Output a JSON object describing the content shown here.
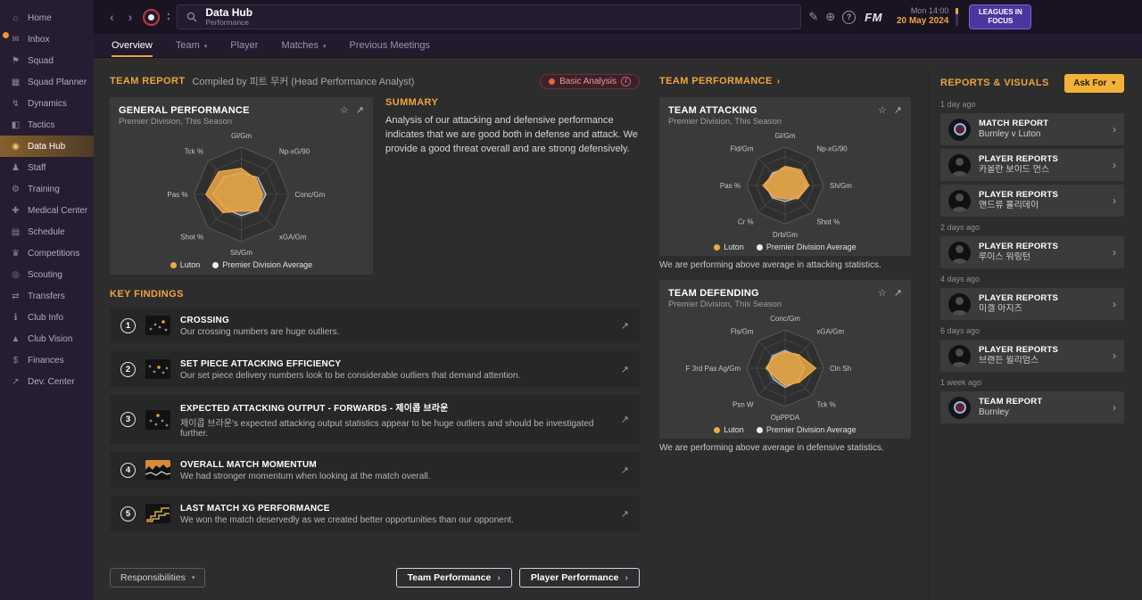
{
  "colors": {
    "accent": "#f0a43c",
    "luton_series": "#edaa43",
    "average_series": "#ececec",
    "badge_bg": "#3f2028",
    "askfor_bg": "#f2b237",
    "leagues_bg": "#4a36a0"
  },
  "icons": {
    "caret_down": "▾",
    "caret_up": "▴",
    "chev_left": "‹",
    "chev_right": "›",
    "star": "☆",
    "expand": "↗",
    "pencil": "✎",
    "globe": "⊕",
    "help": "?",
    "info": "i",
    "fm": "FM"
  },
  "sidebar": {
    "items": [
      {
        "name": "home",
        "label": "Home",
        "glyph": "⌂"
      },
      {
        "name": "inbox",
        "label": "Inbox",
        "glyph": "✉"
      },
      {
        "name": "squad",
        "label": "Squad",
        "glyph": "⚑"
      },
      {
        "name": "squad-planner",
        "label": "Squad Planner",
        "glyph": "▦"
      },
      {
        "name": "dynamics",
        "label": "Dynamics",
        "glyph": "↯"
      },
      {
        "name": "tactics",
        "label": "Tactics",
        "glyph": "◧"
      },
      {
        "name": "data-hub",
        "label": "Data Hub",
        "glyph": "◉"
      },
      {
        "name": "staff",
        "label": "Staff",
        "glyph": "♟"
      },
      {
        "name": "training",
        "label": "Training",
        "glyph": "⚙"
      },
      {
        "name": "medical-center",
        "label": "Medical Center",
        "glyph": "✚"
      },
      {
        "name": "schedule",
        "label": "Schedule",
        "glyph": "▤"
      },
      {
        "name": "competitions",
        "label": "Competitions",
        "glyph": "♛"
      },
      {
        "name": "scouting",
        "label": "Scouting",
        "glyph": "◎"
      },
      {
        "name": "transfers",
        "label": "Transfers",
        "glyph": "⇄"
      },
      {
        "name": "club-info",
        "label": "Club Info",
        "glyph": "ℹ"
      },
      {
        "name": "club-vision",
        "label": "Club Vision",
        "glyph": "▲"
      },
      {
        "name": "finances",
        "label": "Finances",
        "glyph": "$"
      },
      {
        "name": "dev-center",
        "label": "Dev. Center",
        "glyph": "↗"
      }
    ]
  },
  "topbar": {
    "title": "Data Hub",
    "subtitle": "Performance",
    "time": "Mon 14:00",
    "date": "20 May 2024",
    "leagues_button": "LEAGUES IN FOCUS"
  },
  "tabs": [
    {
      "label": "Overview"
    },
    {
      "label": "Team"
    },
    {
      "label": "Player"
    },
    {
      "label": "Matches"
    },
    {
      "label": "Previous Meetings"
    }
  ],
  "team_report": {
    "label": "TEAM REPORT",
    "compiled": "Compiled by 피트 무커 (Head Performance Analyst)",
    "badge": "Basic Analysis"
  },
  "general_performance": {
    "title": "GENERAL PERFORMANCE",
    "subtitle": "Premier Division, This Season"
  },
  "summary": {
    "label": "SUMMARY",
    "text": "Analysis of our attacking and defensive performance indicates that we are good both in defense and attack. We provide a good threat overall and are strong defensively."
  },
  "key_findings": {
    "label": "KEY FINDINGS",
    "items": [
      {
        "num": "1",
        "title": "CROSSING",
        "desc": "Our crossing numbers are huge outliers."
      },
      {
        "num": "2",
        "title": "SET PIECE ATTACKING EFFICIENCY",
        "desc": "Our set piece delivery numbers look to be considerable outliers that demand attention."
      },
      {
        "num": "3",
        "title": "EXPECTED ATTACKING OUTPUT - FORWARDS - 제이콥 브라운",
        "desc": "제이콥 브라운's expected attacking output statistics appear to be huge outliers and should be investigated further."
      },
      {
        "num": "4",
        "title": "OVERALL MATCH MOMENTUM",
        "desc": "We had stronger momentum when looking at the match overall."
      },
      {
        "num": "5",
        "title": "LAST MATCH XG PERFORMANCE",
        "desc": "We won the match deservedly as we created better opportunities than our opponent."
      }
    ]
  },
  "footer": {
    "responsibilities": "Responsibilities",
    "team_performance": "Team Performance",
    "player_performance": "Player Performance"
  },
  "team_performance_col": {
    "label": "TEAM PERFORMANCE",
    "attacking": {
      "title": "TEAM ATTACKING",
      "subtitle": "Premier Division, This Season",
      "note": "We are performing above average in attacking statistics."
    },
    "defending": {
      "title": "TEAM DEFENDING",
      "subtitle": "Premier Division, This Season",
      "note": "We are performing above average in defensive statistics."
    }
  },
  "reports": {
    "label": "REPORTS & VISUALS",
    "ask_for": "Ask For",
    "rows": [
      {
        "kind": "time",
        "text": "1 day ago"
      },
      {
        "kind": "match",
        "type": "MATCH REPORT",
        "subject": "Burnley v Luton"
      },
      {
        "kind": "player",
        "type": "PLAYER REPORTS",
        "subject": "카올란 보이드 먼스"
      },
      {
        "kind": "player",
        "type": "PLAYER REPORTS",
        "subject": "앤드류 홀리데이"
      },
      {
        "kind": "time",
        "text": "2 days ago"
      },
      {
        "kind": "player",
        "type": "PLAYER REPORTS",
        "subject": "루이스 워링턴"
      },
      {
        "kind": "time",
        "text": "4 days ago"
      },
      {
        "kind": "player",
        "type": "PLAYER REPORTS",
        "subject": "미겔 아지즈"
      },
      {
        "kind": "time",
        "text": "6 days ago"
      },
      {
        "kind": "player",
        "type": "PLAYER REPORTS",
        "subject": "브랜든 윌리엄스"
      },
      {
        "kind": "time",
        "text": "1 week ago"
      },
      {
        "kind": "team",
        "type": "TEAM REPORT",
        "subject": "Burnley"
      }
    ]
  },
  "chart_data": [
    {
      "type": "radar",
      "title": "GENERAL PERFORMANCE",
      "range": [
        0,
        1
      ],
      "legend_position": "bottom",
      "axes": [
        "Gl/Gm",
        "Np-xG/90",
        "Conc/Gm",
        "xGA/Gm",
        "Sh/Gm",
        "Shot %",
        "Pas %",
        "Tck %"
      ],
      "series": [
        {
          "name": "Luton",
          "values": [
            0.55,
            0.45,
            0.45,
            0.5,
            0.35,
            0.55,
            0.75,
            0.68
          ]
        },
        {
          "name": "Premier Division Average",
          "values": [
            0.45,
            0.5,
            0.52,
            0.48,
            0.45,
            0.45,
            0.6,
            0.52
          ]
        }
      ]
    },
    {
      "type": "radar",
      "title": "TEAM ATTACKING",
      "range": [
        0,
        1
      ],
      "legend_position": "bottom",
      "axes": [
        "Gl/Gm",
        "Np-xG/90",
        "Sh/Gm",
        "Shot %",
        "Drb/Gm",
        "Cr %",
        "Pas %",
        "Fld/Gm"
      ],
      "series": [
        {
          "name": "Luton",
          "values": [
            0.5,
            0.58,
            0.62,
            0.48,
            0.35,
            0.42,
            0.58,
            0.42
          ]
        },
        {
          "name": "Premier Division Average",
          "values": [
            0.44,
            0.5,
            0.55,
            0.45,
            0.42,
            0.46,
            0.52,
            0.46
          ]
        }
      ]
    },
    {
      "type": "radar",
      "title": "TEAM DEFENDING",
      "range": [
        0,
        1
      ],
      "legend_position": "bottom",
      "axes": [
        "Conc/Gm",
        "xGA/Gm",
        "Cln Sh",
        "Tck %",
        "OpPPDA",
        "Psn W",
        "F 3rd Pas Ag/Gm",
        "Fls/Gm"
      ],
      "series": [
        {
          "name": "Luton",
          "values": [
            0.42,
            0.5,
            0.8,
            0.52,
            0.45,
            0.35,
            0.5,
            0.42
          ]
        },
        {
          "name": "Premier Division Average",
          "values": [
            0.46,
            0.46,
            0.5,
            0.48,
            0.5,
            0.42,
            0.46,
            0.46
          ]
        }
      ]
    }
  ]
}
